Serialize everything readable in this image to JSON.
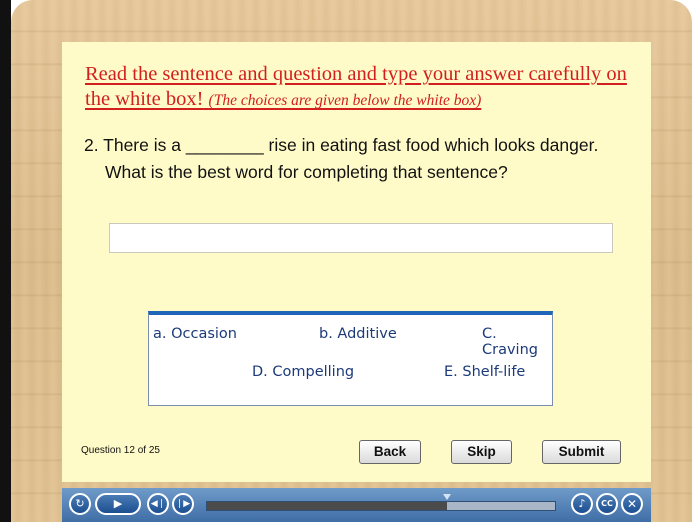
{
  "instruction": {
    "text": "Read the sentence and question and type your answer carefully on the white box!",
    "note": "(The choices are given below the white box)"
  },
  "question": {
    "line1": "2. There is a ________ rise in eating fast food which looks danger.",
    "line2": "What is the best word for completing that sentence?"
  },
  "answer": {
    "value": "",
    "placeholder": ""
  },
  "choices": [
    "a. Occasion",
    "b. Additive",
    "C. Craving",
    "D. Compelling",
    "E. Shelf-life"
  ],
  "counter": "Question 12 of 25",
  "buttons": {
    "back": "Back",
    "skip": "Skip",
    "submit": "Submit"
  },
  "player": {
    "progress": 0.69,
    "controls": [
      "replay-icon",
      "play-icon",
      "previous-icon",
      "next-icon",
      "volume-icon",
      "captions-icon",
      "close-icon"
    ],
    "cc_label": "CC"
  },
  "colors": {
    "instruction": "#d11f1f",
    "choice_text": "#1c3a7a",
    "panel": "#fffbc9",
    "choice_border": "#1f65b8"
  }
}
